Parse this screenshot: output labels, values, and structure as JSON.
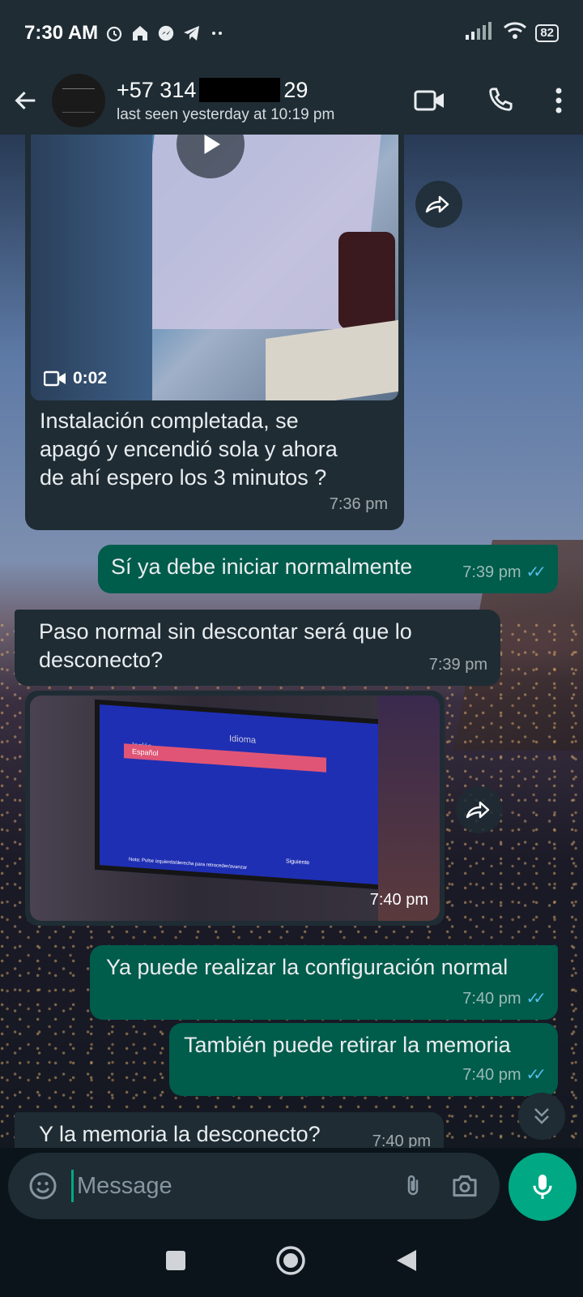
{
  "status_bar": {
    "time": "7:30 AM",
    "battery": "82"
  },
  "header": {
    "name_prefix": "+57 314",
    "name_suffix": "29",
    "last_seen": "last seen yesterday at 10:19 pm"
  },
  "messages": [
    {
      "video_duration": "0:02",
      "text": "Instalación completada, se apagó y encendió sola y ahora de ahí espero los 3 minutos ?",
      "time": "7:36 pm"
    },
    {
      "text": "Sí ya debe iniciar normalmente",
      "time": "7:39 pm"
    },
    {
      "text": "Paso normal sin descontar será que lo desconecto?",
      "time": "7:39 pm"
    },
    {
      "time": "7:40 pm",
      "photo": {
        "title": "Idioma",
        "option1": "Inglés",
        "option2": "Español",
        "note": "Nota: Pulse izquierda/derecha para retroceder/avanzar",
        "button": "Siguiente"
      }
    },
    {
      "text": "Ya puede realizar la configuración normal",
      "time": "7:40 pm"
    },
    {
      "text": "También puede retirar la memoria",
      "time": "7:40 pm"
    },
    {
      "text": "Y la memoria la desconecto?",
      "time": "7:40 pm"
    }
  ],
  "input": {
    "placeholder": "Message"
  },
  "colors": {
    "incoming": "#1f2c34",
    "outgoing": "#005c4b",
    "accent": "#00a884",
    "read_ticks": "#53bdeb"
  },
  "icons": [
    "alarm-icon",
    "home-icon",
    "messenger-icon",
    "telegram-icon",
    "signal-icon",
    "wifi-icon",
    "back-arrow-icon",
    "video-call-icon",
    "phone-icon",
    "more-vert-icon",
    "forward-icon",
    "video-icon",
    "emoji-icon",
    "attach-icon",
    "camera-icon",
    "mic-icon",
    "chevron-double-down-icon",
    "nav-square-icon",
    "nav-circle-icon",
    "nav-back-icon"
  ]
}
